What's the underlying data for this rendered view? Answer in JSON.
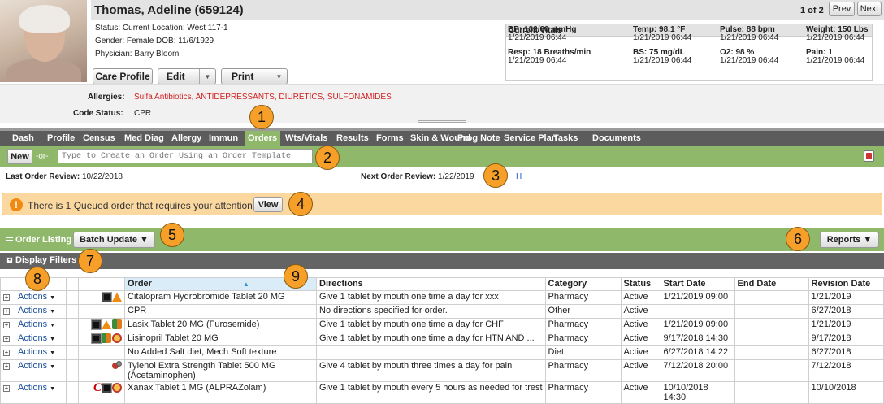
{
  "patient": {
    "name": "Thomas, Adeline (659124)",
    "status_line": "Status: Current   Location: West 117-1",
    "gender_line": "Gender: Female     DOB: 11/6/1929",
    "physician_line": "Physician: Barry Bloom"
  },
  "pager": {
    "count": "1 of 2",
    "prev": "Prev",
    "next": "Next"
  },
  "buttons": {
    "care_profile": "Care Profile",
    "edit": "Edit",
    "print": "Print"
  },
  "vitals": {
    "title": "Current Vitals",
    "items": [
      {
        "label": "BP:",
        "value": "132/60 mmHg",
        "time": "1/21/2019 06:44"
      },
      {
        "label": "Temp:",
        "value": "98.1 °F",
        "time": "1/21/2019 06:44"
      },
      {
        "label": "Pulse:",
        "value": "88 bpm",
        "time": "1/21/2019 06:44"
      },
      {
        "label": "Weight:",
        "value": "150 Lbs",
        "time": "1/21/2019 06:44"
      },
      {
        "label": "Resp:",
        "value": "18 Breaths/min",
        "time": "1/21/2019 06:44"
      },
      {
        "label": "BS:",
        "value": "75 mg/dL",
        "time": "1/21/2019 06:44"
      },
      {
        "label": "O2:",
        "value": "98 %",
        "time": "1/21/2019 06:44"
      },
      {
        "label": "Pain:",
        "value": "1",
        "time": "1/21/2019 06:44"
      }
    ]
  },
  "allergies": {
    "label": "Allergies:",
    "value": "Sulfa Antibiotics, ANTIDEPRESSANTS, DIURETICS, SULFONAMIDES"
  },
  "code_status": {
    "label": "Code Status:",
    "value": "CPR"
  },
  "tabs": [
    "Dash",
    "Profile",
    "Census",
    "Med Diag",
    "Allergy",
    "Immun",
    "Orders",
    "Wts/Vitals",
    "Results",
    "Forms",
    "Skin & Wound",
    "Prog Note",
    "Service Plan",
    "Tasks",
    "Documents"
  ],
  "new_order": {
    "button": "New",
    "or": "-or-",
    "placeholder": "Type to Create an Order Using an Order Template"
  },
  "review": {
    "last_label": "Last Order Review:",
    "last_value": "10/22/2018",
    "next_label": "Next Order Review:",
    "next_value": "1/22/2019",
    "h_link": "H"
  },
  "alert": {
    "text": "There is 1 Queued order that requires your attention.",
    "view": "View",
    "icon_text": "!"
  },
  "order_listing": {
    "label": "Order Listing",
    "batch": "Batch Update ▼",
    "reports": "Reports ▼"
  },
  "display_filters": "Display Filters",
  "badges": [
    "1",
    "2",
    "3",
    "4",
    "5",
    "6",
    "7",
    "8",
    "9"
  ],
  "table": {
    "headers": [
      "Order",
      "Directions",
      "Category",
      "Status",
      "Start Date",
      "End Date",
      "Revision Date"
    ],
    "actions_label": "Actions",
    "rows": [
      {
        "icons": [
          "black-square",
          "warning"
        ],
        "order": "Citalopram Hydrobromide Tablet 20 MG",
        "directions": "Give 1 tablet by mouth one time a day for xxx",
        "category": "Pharmacy",
        "status": "Active",
        "start": "1/21/2019 09:00",
        "end": "",
        "revision": "1/21/2019"
      },
      {
        "icons": [],
        "order": "CPR",
        "directions": "No directions specified for order.",
        "category": "Other",
        "status": "Active",
        "start": "",
        "end": "",
        "revision": "6/27/2018"
      },
      {
        "icons": [
          "black-square",
          "warning",
          "pharmacy-leaf"
        ],
        "order": "Lasix Tablet 20 MG (Furosemide)",
        "directions": "Give 1 tablet by mouth one time a day for CHF",
        "category": "Pharmacy",
        "status": "Active",
        "start": "1/21/2019 09:00",
        "end": "",
        "revision": "1/21/2019"
      },
      {
        "icons": [
          "black-square",
          "pharmacy-leaf",
          "no-dose"
        ],
        "order": "Lisinopril Tablet 20 MG",
        "directions": "Give 1 tablet by mouth one time a day for HTN AND ...",
        "category": "Pharmacy",
        "status": "Active",
        "start": "9/17/2018 14:30",
        "end": "",
        "revision": "9/17/2018"
      },
      {
        "icons": [],
        "order": "No Added Salt diet, Mech Soft texture",
        "directions": "",
        "category": "Diet",
        "status": "Active",
        "start": "6/27/2018 14:22",
        "end": "",
        "revision": "6/27/2018"
      },
      {
        "icons": [
          "prn"
        ],
        "order": "Tylenol Extra Strength Tablet 500 MG (Acetaminophen)",
        "directions": "Give 4 tablet by mouth three times a day for pain",
        "category": "Pharmacy",
        "status": "Active",
        "start": "7/12/2018 20:00",
        "end": "",
        "revision": "7/12/2018"
      },
      {
        "icons": [
          "controlled-c",
          "black-square",
          "no-dose"
        ],
        "order": "Xanax Tablet 1 MG (ALPRAZolam)",
        "directions": "Give 1 tablet by mouth every 5 hours as needed for trest",
        "category": "Pharmacy",
        "status": "Active",
        "start": "10/10/2018 14:30",
        "end": "",
        "revision": "10/10/2018"
      }
    ]
  }
}
